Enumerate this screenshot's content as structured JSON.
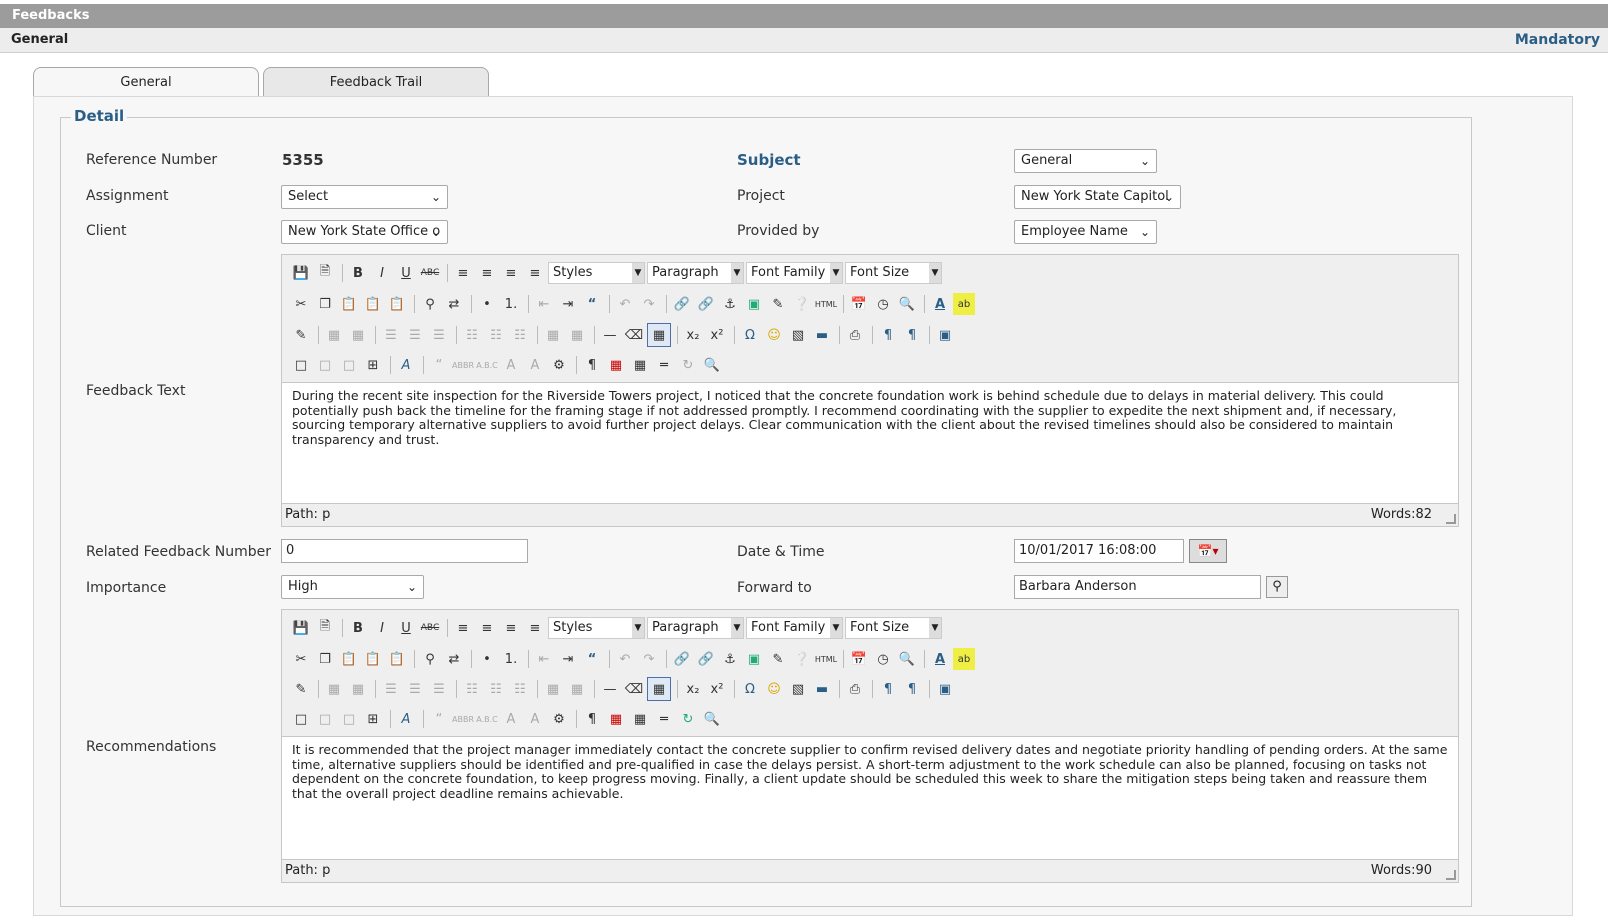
{
  "window": {
    "title": "Feedbacks"
  },
  "header": {
    "section": "General",
    "mandatory_link": "Mandatory"
  },
  "tabs": [
    {
      "label": "General",
      "active": true
    },
    {
      "label": "Feedback Trail",
      "active": false
    }
  ],
  "fieldset": {
    "legend": "Detail"
  },
  "fields": {
    "reference_number": {
      "label": "Reference Number",
      "value": "5355"
    },
    "subject": {
      "label": "Subject",
      "value": "General"
    },
    "assignment": {
      "label": "Assignment",
      "value": "Select"
    },
    "project": {
      "label": "Project",
      "value": "New York State Capitol"
    },
    "client": {
      "label": "Client",
      "value": "New York State Office o"
    },
    "provided_by": {
      "label": "Provided by",
      "value": "Employee Name"
    },
    "feedback_text": {
      "label": "Feedback Text",
      "value": "During the recent site inspection for the Riverside Towers project, I noticed that the concrete foundation work is behind schedule due to delays in material delivery. This could potentially push back the timeline for the framing stage if not addressed promptly. I recommend coordinating with the supplier to expedite the next shipment and, if necessary, sourcing temporary alternative suppliers to avoid further project delays. Clear communication with the client about the revised timelines should also be considered to maintain transparency and trust.",
      "path": "Path: p",
      "words": "Words:82"
    },
    "related_feedback_number": {
      "label": "Related Feedback Number",
      "value": "0"
    },
    "date_time": {
      "label": "Date & Time",
      "value": "10/01/2017 16:08:00"
    },
    "importance": {
      "label": "Importance",
      "value": "High"
    },
    "forward_to": {
      "label": "Forward to",
      "value": "Barbara Anderson"
    },
    "recommendations": {
      "label": "Recommendations",
      "value": "It is recommended that the project manager immediately contact the concrete supplier to confirm revised delivery dates and negotiate priority handling of pending orders. At the same time, alternative suppliers should be identified and pre-qualified in case the delays persist. A short-term adjustment to the work schedule can also be planned, focusing on tasks not dependent on the concrete foundation, to keep progress moving. Finally, a client update should be scheduled this week to share the mitigation steps being taken and reassure them that the overall project deadline remains achievable.",
      "path": "Path: p",
      "words": "Words:90"
    }
  },
  "editor_toolbar": {
    "styles": "Styles",
    "paragraph": "Paragraph",
    "font_family": "Font Family",
    "font_size": "Font Size"
  },
  "colors": {
    "accent": "#2b5e86",
    "titlebar": "#9c9c9c"
  }
}
